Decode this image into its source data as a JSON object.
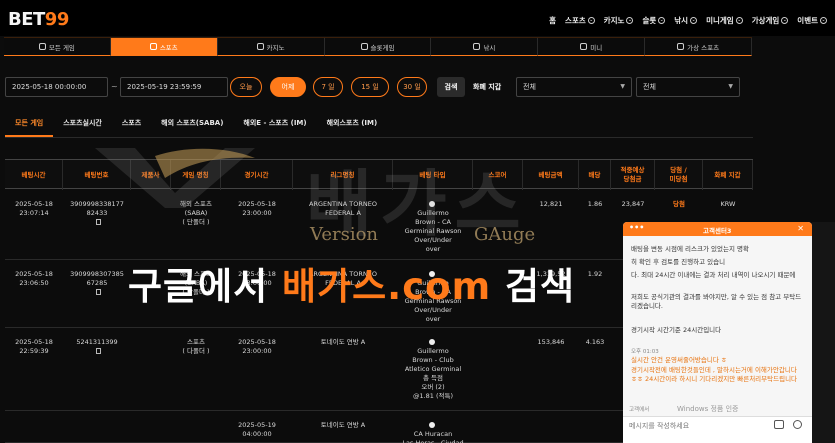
{
  "logo": {
    "text": "BET",
    "num": "99"
  },
  "nav": [
    {
      "label": "홈",
      "chev": false
    },
    {
      "label": "스포츠",
      "chev": true
    },
    {
      "label": "카지노",
      "chev": true
    },
    {
      "label": "슬롯",
      "chev": true
    },
    {
      "label": "낚시",
      "chev": true
    },
    {
      "label": "미니게임",
      "chev": true
    },
    {
      "label": "가상게임",
      "chev": true
    },
    {
      "label": "이벤트",
      "chev": true
    }
  ],
  "categories": [
    {
      "label": "모든 게임",
      "active": false
    },
    {
      "label": "스포츠",
      "active": true
    },
    {
      "label": "카지노",
      "active": false
    },
    {
      "label": "슬롯게임",
      "active": false
    },
    {
      "label": "낚시",
      "active": false
    },
    {
      "label": "미니",
      "active": false
    },
    {
      "label": "가상 스포츠",
      "active": false
    }
  ],
  "filters": {
    "date_from": "2025-05-18 00:00:00",
    "tilde": "~",
    "date_to": "2025-05-19 23:59:59",
    "periods": [
      {
        "label": "오늘",
        "active": false
      },
      {
        "label": "어제",
        "active": true
      },
      {
        "label": "7 일",
        "active": false
      },
      {
        "label": "15 일",
        "active": false
      },
      {
        "label": "30 일",
        "active": false
      }
    ],
    "search_label": "검색",
    "currency_label": "화폐 지갑",
    "select1": "전체",
    "select2": "전체"
  },
  "subtabs": [
    {
      "label": "모든 게임",
      "active": true
    },
    {
      "label": "스포츠실시간",
      "active": false
    },
    {
      "label": "스포츠",
      "active": false
    },
    {
      "label": "해외 스포츠(SABA)",
      "active": false
    },
    {
      "label": "해외E - 스포츠 (IM)",
      "active": false
    },
    {
      "label": "해외스포츠 (IM)",
      "active": false
    }
  ],
  "table": {
    "headers": [
      "베팅시간",
      "베팅번호",
      "제품사",
      "게임 명칭",
      "경기시간",
      "리그명칭",
      "베팅 타입",
      "스코어",
      "베팅금액",
      "배당",
      "적중예상\n당첨금",
      "당첨 /\n미당첨",
      "화폐 지갑"
    ],
    "rows": [
      {
        "time": "2025-05-18 23:07:14",
        "bet_no1": "3909998338177",
        "bet_no2": "82433",
        "provider": "",
        "game1": "해외 스포츠",
        "game2": "(SABA)",
        "game3": "( 단폴더 )",
        "match1": "2025-05-18",
        "match2": "23:00:00",
        "league1": "ARGENTINA TORNEO",
        "league2": "FEDERAL A",
        "type1": "Guillermo",
        "type2": "Brown - CA",
        "type3": "Germinal Rawson",
        "type4": "Over/Under",
        "type5": "over",
        "score": "",
        "amount": "12,821",
        "odds": "1.86",
        "expected": "23,847",
        "result": "당첨",
        "currency": "KRW"
      },
      {
        "time": "2025-05-18 23:06:50",
        "bet_no1": "3909998307385",
        "bet_no2": "67285",
        "provider": "",
        "game1": "해외 스포츠",
        "game2": "(SABA)",
        "game3": "( 단폴더 )",
        "match1": "2025-05-18",
        "match2": "23:00:00",
        "league1": "ARGENTINA TORNEO",
        "league2": "FEDERAL A",
        "type1": "Guillermo",
        "type2": "Brown - CA",
        "type3": "Germinal Rawson",
        "type4": "Over/Under",
        "type5": "over",
        "score": "",
        "amount": "1,319,52",
        "odds": "1.92",
        "expected": "",
        "result": "",
        "currency": ""
      },
      {
        "time": "2025-05-18 22:59:39",
        "bet_no1": "5241311399",
        "bet_no2": "",
        "provider": "",
        "game1": "스포츠",
        "game2": "( 다폴더 )",
        "game3": "",
        "match1": "2025-05-18",
        "match2": "23:00:00",
        "league1": "토네이도 연방 A",
        "league2": "",
        "type1": "Guillermo",
        "type2": "Brown - Club",
        "type3": "Atletico Germinal",
        "type4": "총 득점",
        "type5": "오버 (2)",
        "type6": "@1.81 (적특)",
        "score": "",
        "amount": "153,846",
        "odds": "4.163",
        "expected": "",
        "result": "",
        "currency": ""
      },
      {
        "time": "",
        "bet_no1": "",
        "bet_no2": "",
        "provider": "",
        "game1": "",
        "game2": "",
        "game3": "",
        "match1": "2025-05-19",
        "match2": "04:00:00",
        "league1": "토네이도 연방 A",
        "league2": "",
        "type1": "CA Huracan",
        "type2": "Las Heras - Ciudad",
        "type3": "",
        "type4": "",
        "type5": "",
        "score": "",
        "amount": "",
        "odds": "",
        "expected": "",
        "result": "",
        "currency": ""
      }
    ]
  },
  "watermark": {
    "big": "배가스",
    "version": "Version",
    "gauge": "GAuge",
    "banner_pre": "구글에서 ",
    "banner_hl": "배가스.com",
    "banner_post": " 검색"
  },
  "chat": {
    "title": "고객센터3",
    "dots": "•••",
    "close": "✕",
    "msg1": "배팅을 변동 시점에 리스크가 있었는지 명확",
    "msg2": "히 확인 후 검토를 진행하고 있습니",
    "msg3": "다. 최대 24시간 이내에는 결과 처리 내역이 나오시기 때문에",
    "msg4": "저희도 공식기관의 결과를 봐야지만, 알 수 있는 점 참고 부탁드리겠습니다.",
    "msg5": "경기시작 시간기준 24시간입니다",
    "ts1": "오후 01:03",
    "msg6": "실시간 안건 운영써줄어방습니다 ㅎ",
    "msg7": "경기시작전에 배팅한것들인데 , 말하시는거에 이해가안갑니다 ㅎㅎ 24시간이라 하시니 기다리겠지만 빠른처리부탁드립니다",
    "counter": "고객에서",
    "windows": "Windows 정품 인증",
    "placeholder": "메시지를 작성하세요"
  }
}
